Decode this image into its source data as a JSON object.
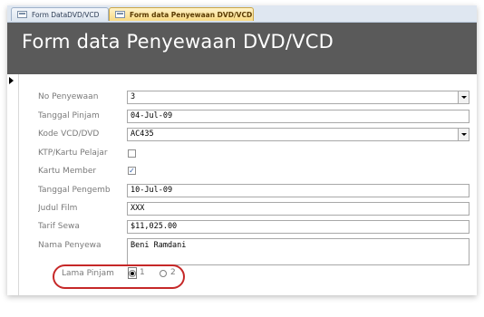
{
  "tabs": [
    {
      "label": "Form DataDVD/VCD",
      "active": false
    },
    {
      "label": "Form data Penyewaan DVD/VCD",
      "active": true
    }
  ],
  "form": {
    "title": "Form data Penyewaan DVD/VCD"
  },
  "fields": {
    "no_penyewaan": {
      "label": "No Penyewaan",
      "value": "3"
    },
    "tanggal_pinjam": {
      "label": "Tanggal Pinjam",
      "value": "04-Jul-09"
    },
    "kode_vcd_dvd": {
      "label": "Kode VCD/DVD",
      "value": "AC435"
    },
    "ktp_kartu_pelajar": {
      "label": "KTP/Kartu Pelajar",
      "checked": false
    },
    "kartu_member": {
      "label": "Kartu Member",
      "checked": true,
      "mark": "✓"
    },
    "tanggal_pengembalian": {
      "label": "Tanggal Pengemb",
      "value": "10-Jul-09"
    },
    "judul_film": {
      "label": "Judul Film",
      "value": "XXX"
    },
    "tarif_sewa": {
      "label": "Tarif Sewa",
      "value": "$11,025.00"
    },
    "nama_penyewa": {
      "label": "Nama Penyewa",
      "value": "Beni Ramdani"
    }
  },
  "lama_pinjam": {
    "label": "Lama Pinjam",
    "options": [
      "1",
      "2"
    ],
    "selected": "1"
  },
  "colors": {
    "header_bg": "#5a5a5a",
    "highlight_ring": "#c62828",
    "active_tab": "#f8d983"
  }
}
